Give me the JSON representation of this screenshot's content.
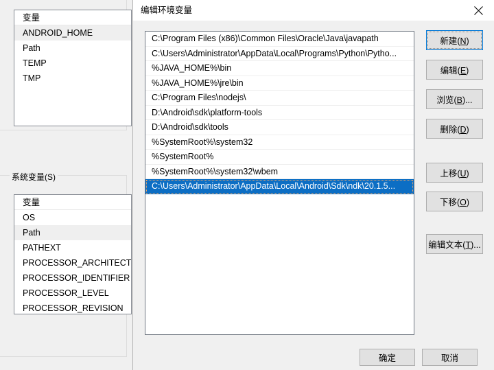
{
  "background_window": {
    "user_variables": {
      "list_header": "变量",
      "items": [
        {
          "name": "ANDROID_HOME",
          "selected": true
        },
        {
          "name": "Path",
          "selected": false
        },
        {
          "name": "TEMP",
          "selected": false
        },
        {
          "name": "TMP",
          "selected": false
        }
      ]
    },
    "system_variables": {
      "group_label": "系统变量(S)",
      "list_header": "变量",
      "items": [
        {
          "name": "OS",
          "selected": false
        },
        {
          "name": "Path",
          "selected": true
        },
        {
          "name": "PATHEXT",
          "selected": false
        },
        {
          "name": "PROCESSOR_ARCHITECT...",
          "selected": false
        },
        {
          "name": "PROCESSOR_IDENTIFIER",
          "selected": false
        },
        {
          "name": "PROCESSOR_LEVEL",
          "selected": false
        },
        {
          "name": "PROCESSOR_REVISION",
          "selected": false
        }
      ]
    }
  },
  "dialog": {
    "title": "编辑环境变量",
    "close_icon": "close-icon",
    "path_entries": [
      {
        "value": "C:\\Program Files (x86)\\Common Files\\Oracle\\Java\\javapath",
        "selected": false
      },
      {
        "value": "C:\\Users\\Administrator\\AppData\\Local\\Programs\\Python\\Pytho...",
        "selected": false
      },
      {
        "value": "%JAVA_HOME%\\bin",
        "selected": false
      },
      {
        "value": "%JAVA_HOME%\\jre\\bin",
        "selected": false
      },
      {
        "value": "C:\\Program Files\\nodejs\\",
        "selected": false
      },
      {
        "value": "D:\\Android\\sdk\\platform-tools",
        "selected": false
      },
      {
        "value": "D:\\Android\\sdk\\tools",
        "selected": false
      },
      {
        "value": "%SystemRoot%\\system32",
        "selected": false
      },
      {
        "value": "%SystemRoot%",
        "selected": false
      },
      {
        "value": "%SystemRoot%\\system32\\wbem",
        "selected": false
      },
      {
        "value": "C:\\Users\\Administrator\\AppData\\Local\\Android\\Sdk\\ndk\\20.1.5...",
        "selected": true
      }
    ],
    "side_buttons": {
      "new": {
        "text": "新建(N)",
        "pre": "新建(",
        "key": "N",
        "post": ")"
      },
      "edit": {
        "text": "编辑(E)",
        "pre": "编辑(",
        "key": "E",
        "post": ")"
      },
      "browse": {
        "text": "浏览(B)...",
        "pre": "浏览(",
        "key": "B",
        "post": ")..."
      },
      "delete": {
        "text": "删除(D)",
        "pre": "删除(",
        "key": "D",
        "post": ")"
      },
      "move_up": {
        "text": "上移(U)",
        "pre": "上移(",
        "key": "U",
        "post": ")"
      },
      "move_down": {
        "text": "下移(O)",
        "pre": "下移(",
        "key": "O",
        "post": ")"
      },
      "edit_text": {
        "text": "编辑文本(T)...",
        "pre": "编辑文本(",
        "key": "T",
        "post": ")..."
      }
    },
    "footer_buttons": {
      "ok": "确定",
      "cancel": "取消"
    }
  },
  "colors": {
    "selection_blue": "#0c6ec4",
    "dialog_bg": "#f0f0f0",
    "listbox_border": "#6e7680",
    "button_face": "#e1e1e1",
    "focus_blue": "#0078d7"
  }
}
